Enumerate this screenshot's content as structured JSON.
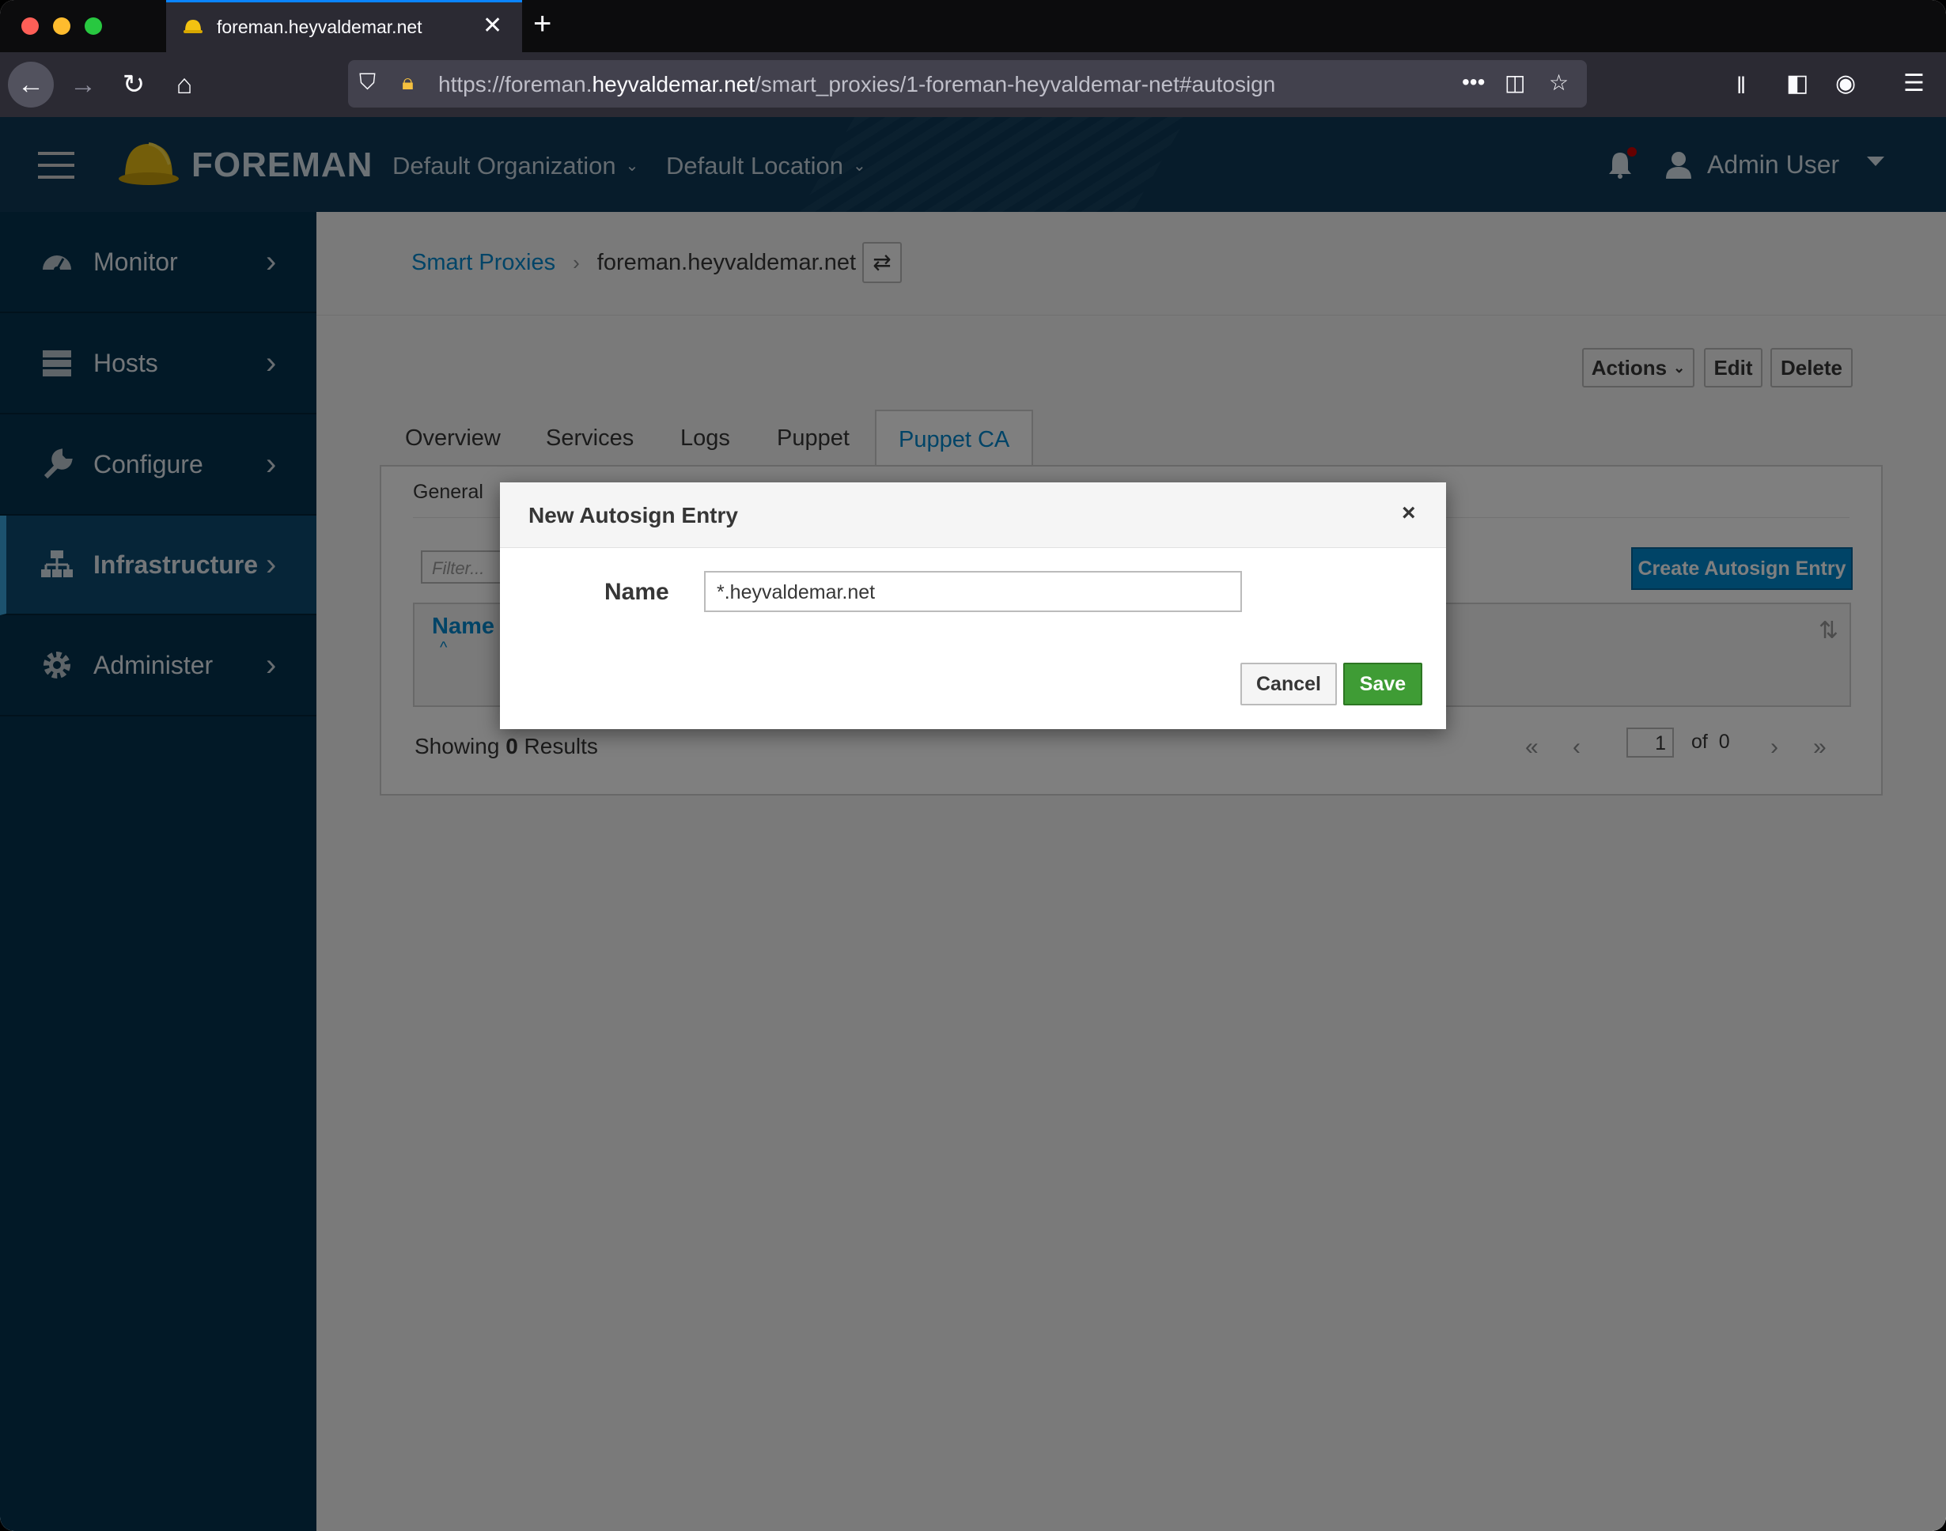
{
  "browser": {
    "tab_title": "foreman.heyvaldemar.net",
    "url_prefix": "https://foreman.",
    "url_domain": "heyvaldemar.net",
    "url_path": "/smart_proxies/1-foreman-heyvaldemar-net#autosign"
  },
  "topnav": {
    "brand": "FOREMAN",
    "organization": "Default Organization",
    "location": "Default Location",
    "user": "Admin User"
  },
  "sidebar": {
    "items": [
      {
        "label": "Monitor",
        "icon": "dashboard-icon"
      },
      {
        "label": "Hosts",
        "icon": "server-icon"
      },
      {
        "label": "Configure",
        "icon": "wrench-icon"
      },
      {
        "label": "Infrastructure",
        "icon": "network-icon"
      },
      {
        "label": "Administer",
        "icon": "gear-icon"
      }
    ]
  },
  "breadcrumb": {
    "parent": "Smart Proxies",
    "current": "foreman.heyvaldemar.net"
  },
  "actions": {
    "actions_label": "Actions",
    "edit_label": "Edit",
    "delete_label": "Delete"
  },
  "tabs": [
    "Overview",
    "Services",
    "Logs",
    "Puppet",
    "Puppet CA"
  ],
  "panel": {
    "subtab": "General",
    "filter_placeholder": "Filter...",
    "create_button": "Create Autosign Entry",
    "column_name": "Name",
    "showing_prefix": "Showing ",
    "showing_count": "0",
    "showing_suffix": " Results",
    "page_value": "1",
    "of_label": "of",
    "page_total": "0"
  },
  "modal": {
    "title": "New Autosign Entry",
    "close": "×",
    "name_label": "Name",
    "name_value": "*.heyvaldemar.net",
    "cancel_label": "Cancel",
    "save_label": "Save"
  },
  "colors": {
    "topnav": "#0e3957",
    "sidebar": "#05334f",
    "link": "#0088ce",
    "save": "#3f9c35"
  }
}
